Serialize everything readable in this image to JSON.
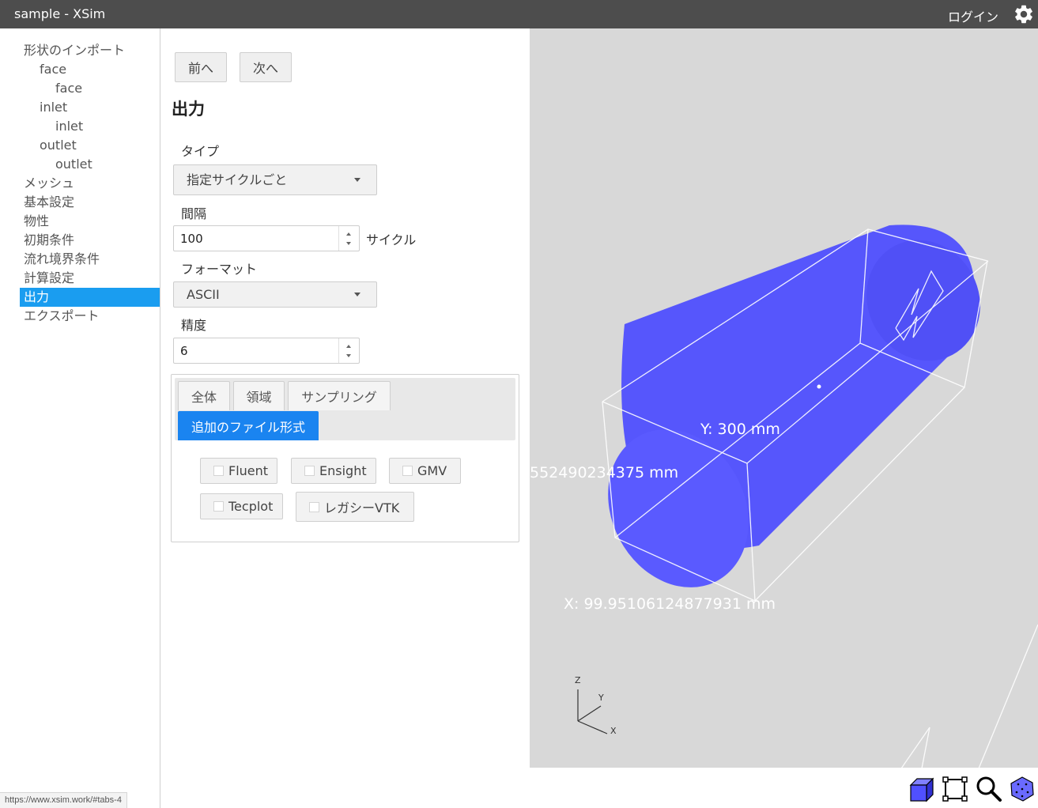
{
  "window": {
    "title": "sample - XSim",
    "login_label": "ログイン",
    "status_url": "https://www.xsim.work/#tabs-4"
  },
  "sidebar": {
    "items": [
      {
        "label": "形状のインポート",
        "level": 0
      },
      {
        "label": "face",
        "level": 1
      },
      {
        "label": "face",
        "level": 2
      },
      {
        "label": "inlet",
        "level": 1
      },
      {
        "label": "inlet",
        "level": 2
      },
      {
        "label": "outlet",
        "level": 1
      },
      {
        "label": "outlet",
        "level": 2
      },
      {
        "label": "メッシュ",
        "level": 0
      },
      {
        "label": "基本設定",
        "level": 0
      },
      {
        "label": "物性",
        "level": 0
      },
      {
        "label": "初期条件",
        "level": 0
      },
      {
        "label": "流れ境界条件",
        "level": 0
      },
      {
        "label": "計算設定",
        "level": 0
      },
      {
        "label": "出力",
        "level": 0,
        "active": true
      },
      {
        "label": "エクスポート",
        "level": 0
      }
    ]
  },
  "panel": {
    "prev_label": "前へ",
    "next_label": "次へ",
    "title": "出力",
    "type": {
      "label": "タイプ",
      "selected": "指定サイクルごと"
    },
    "interval": {
      "label": "間隔",
      "value": "100",
      "unit": "サイクル"
    },
    "format": {
      "label": "フォーマット",
      "selected": "ASCII"
    },
    "precision": {
      "label": "精度",
      "value": "6"
    },
    "tabs": [
      {
        "label": "全体",
        "active": false
      },
      {
        "label": "領域",
        "active": false
      },
      {
        "label": "サンプリング",
        "active": false
      },
      {
        "label": "追加のファイル形式",
        "active": true
      }
    ],
    "file_formats": [
      {
        "label": "Fluent",
        "checked": false
      },
      {
        "label": "Ensight",
        "checked": false
      },
      {
        "label": "GMV",
        "checked": false
      },
      {
        "label": "Tecplot",
        "checked": false
      },
      {
        "label": "レガシーVTK",
        "checked": false
      }
    ]
  },
  "viewport": {
    "dim_y": "Y: 300 mm",
    "dim_z": "552490234375 mm",
    "dim_x": "X: 99.95106124877931 mm",
    "axis_labels": {
      "z": "Z",
      "y": "Y",
      "x": "X"
    },
    "cylinder_color": "#4b4bff",
    "background_color": "#d8d8d8"
  },
  "toolbar": {
    "icons": [
      "cube-view-icon",
      "fit-view-icon",
      "zoom-icon",
      "mesh-view-icon"
    ]
  }
}
